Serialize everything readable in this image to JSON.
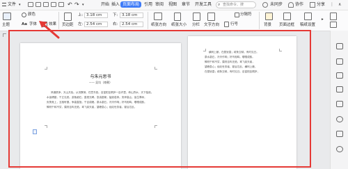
{
  "menubar": {
    "file": "文件",
    "tabs": [
      "开始",
      "插入",
      "页面布局",
      "引用",
      "审阅",
      "视图",
      "章节",
      "开发工具"
    ],
    "active_tab": "页面布局",
    "search_placeholder": "查找命令、搜",
    "unsynced": "未同步",
    "collaborate": "协作",
    "share": "分享"
  },
  "ribbon": {
    "theme": "主题",
    "color": "颜色",
    "font": "字体",
    "effects": "效果",
    "margins": "页边距",
    "top_label": "上:",
    "top_value": "3.18 cm",
    "bottom_label": "下:",
    "bottom_value": "3.18 cm",
    "left_label": "左:",
    "left_value": "2.54 cm",
    "right_label": "右:",
    "right_value": "2.54 cm",
    "orientation": "纸张方向",
    "size": "纸张大小",
    "columns": "分栏",
    "text_direction": "文字方向",
    "line_numbers": "行号",
    "breaks": "分隔符",
    "background": "背景",
    "page_border": "页面边框",
    "draft_settings": "稿纸设置"
  },
  "document": {
    "title": "与朱元思书",
    "author": "—— 吴均（南朝）",
    "left_paragraphs": [
      "风烟俱净，天山共色。从流飘荡，任意东西。自富阳至桐庐一百许里，奇山异水，天下独绝。",
      "水皆缥碧，千丈见底。游鱼细石，直视无碍。急湍甚箭，猛浪若奔。夹岸高山，皆生寒树，",
      "负势竞上，互相轩邈，争高直指，千百成峰。泉水激石，泠泠作响；好鸟相鸣，嘤嘤成韵。",
      "蝉则千转不穷，猿则百叫无绝。鸢飞戾天者，望峰息心；经纶世务者，窥谷忘反。"
    ],
    "right_paragraphs": [
      "横柯上蔽，在昼犹昏；疏条交映，有时见日。",
      "泉水激石，泠泠作响；好鸟相鸣，嘤嘤成韵。",
      "蝉则千转不穷，猿则百叫无绝。鸢飞戾天者，",
      "望峰息心；经纶世务者，窥谷忘反。横柯上蔽，",
      "在昼犹昏；疏条交映，有时见日。自富阳至桐庐，"
    ]
  },
  "colors": {
    "accent": "#3e7bf7",
    "highlight_box": "#e53935",
    "arrow": "#e53935"
  }
}
